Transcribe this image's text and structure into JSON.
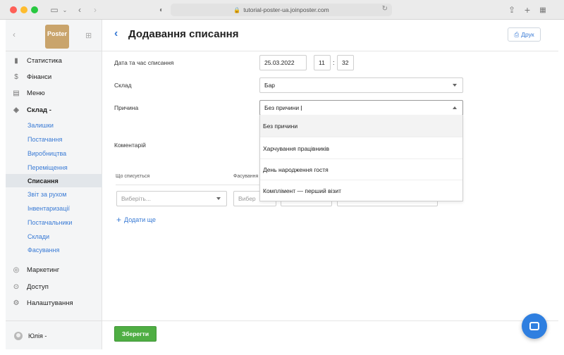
{
  "browser": {
    "url": "tutorial-poster-ua.joinposter.com"
  },
  "sidebar": {
    "logo": "Poster",
    "nav": [
      {
        "label": "Статистика",
        "icon": "bar-chart-icon"
      },
      {
        "label": "Фінанси",
        "icon": "dollar-icon"
      },
      {
        "label": "Меню",
        "icon": "document-icon"
      },
      {
        "label": "Склад -",
        "icon": "layers-icon"
      }
    ],
    "warehouse_sub": [
      "Залишки",
      "Постачання",
      "Виробництва",
      "Переміщення",
      "Списання",
      "Звіт за рухом",
      "Інвентаризації",
      "Постачальники",
      "Склади",
      "Фасування"
    ],
    "active_sub": "Списання",
    "nav_bottom": [
      {
        "label": "Маркетинг",
        "icon": "marketing-icon"
      },
      {
        "label": "Доступ",
        "icon": "lock-icon"
      },
      {
        "label": "Налаштування",
        "icon": "gear-icon"
      }
    ],
    "user": "Юлія -"
  },
  "page": {
    "title": "Додавання списання",
    "print_label": "Друк"
  },
  "form": {
    "date_label": "Дата та час списання",
    "date_value": "25.03.2022",
    "hour": "11",
    "minute": "32",
    "warehouse_label": "Склад",
    "warehouse_value": "Бар",
    "reason_label": "Причина",
    "reason_value": "Без причини",
    "reason_options": [
      "Без причини",
      "Харчування працівників",
      "День народження гостя",
      "Комплімент — перший візит"
    ],
    "comment_label": "Коментарій"
  },
  "table": {
    "headers": [
      "Що списується",
      "Фасування"
    ],
    "item_placeholder": "Виберіть...",
    "pack_placeholder": "Вибер",
    "add_more": "Додати ще"
  },
  "footer": {
    "save_label": "Зберегти"
  }
}
